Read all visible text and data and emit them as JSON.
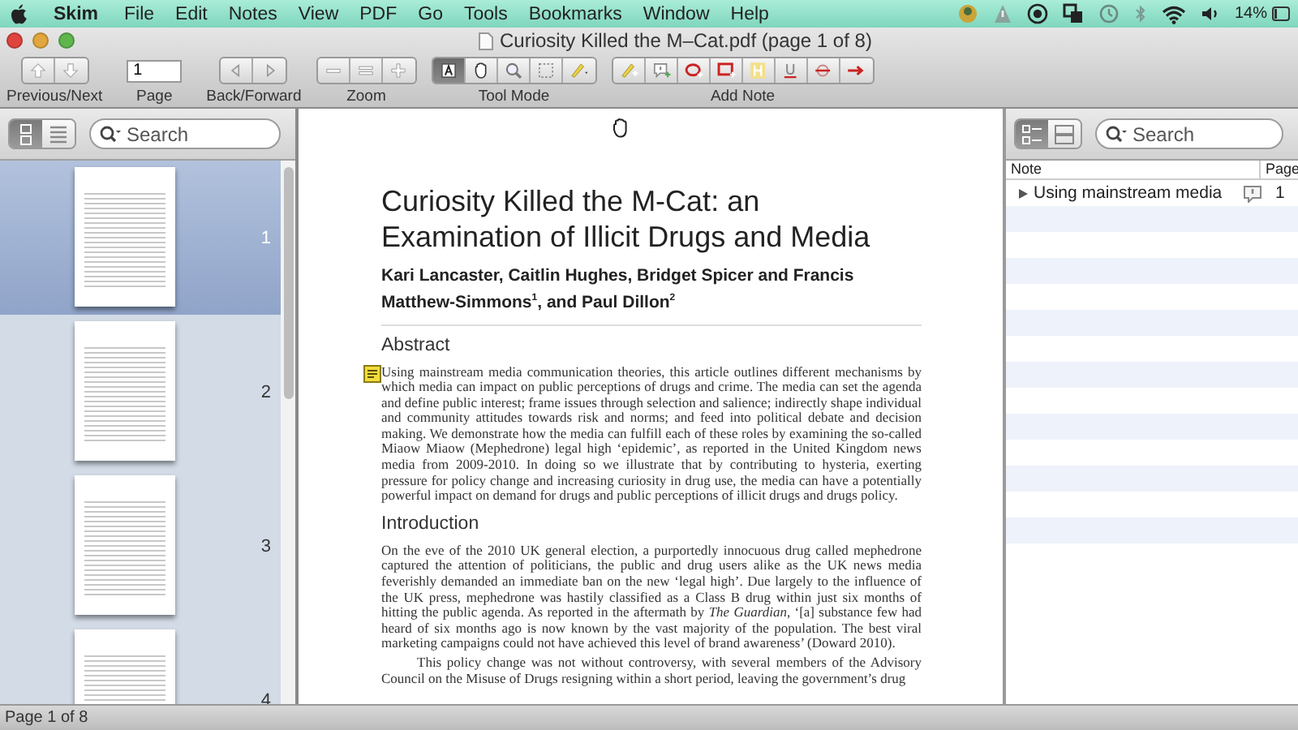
{
  "menu_bar": {
    "items": [
      {
        "label": "Skim",
        "kind": "app"
      },
      {
        "label": "File",
        "kind": "menu"
      },
      {
        "label": "Edit",
        "kind": "menu"
      },
      {
        "label": "Notes",
        "kind": "menu"
      },
      {
        "label": "View",
        "kind": "menu"
      },
      {
        "label": "PDF",
        "kind": "menu"
      },
      {
        "label": "Go",
        "kind": "menu"
      },
      {
        "label": "Tools",
        "kind": "menu"
      },
      {
        "label": "Bookmarks",
        "kind": "menu"
      },
      {
        "label": "Window",
        "kind": "menu"
      },
      {
        "label": "Help",
        "kind": "menu"
      }
    ],
    "battery": "14%"
  },
  "window": {
    "title": "Curiosity Killed the M–Cat.pdf (page 1 of 8)"
  },
  "toolbar": {
    "groups": [
      {
        "kind": "prev_next",
        "label": "Previous/Next"
      },
      {
        "kind": "page",
        "label": "Page",
        "value": "1"
      },
      {
        "kind": "back_forward",
        "label": "Back/Forward"
      },
      {
        "kind": "zoom",
        "label": "Zoom"
      },
      {
        "kind": "tool_mode",
        "label": "Tool Mode",
        "tools": [
          {
            "selected": true
          },
          {
            "selected": false
          },
          {
            "selected": false
          },
          {
            "selected": false
          },
          {
            "selected": false
          }
        ]
      },
      {
        "kind": "add_note",
        "label": "Add Note"
      }
    ]
  },
  "sidebar": {
    "views": [
      {
        "selected": true
      },
      {
        "selected": false
      }
    ],
    "search": {
      "placeholder": "Search"
    },
    "thumbnails": [
      {
        "label": "1",
        "selected": true
      },
      {
        "label": "2",
        "selected": false
      },
      {
        "label": "3",
        "selected": false
      },
      {
        "label": "4",
        "selected": false
      }
    ]
  },
  "document": {
    "title": "Curiosity Killed the M-Cat: an Examination of Illicit Drugs and Media",
    "authors": "Kari Lancaster, Caitlin Hughes, Bridget Spicer and Francis Matthew-Simmons$^{1}$, and Paul Dillon$^{2}$",
    "sections": [
      {
        "kind": "heading",
        "text": "Abstract"
      },
      {
        "kind": "paragraph",
        "note": true,
        "text": "Using mainstream media communication theories, this article outlines different mechanisms by which media can impact on public perceptions of drugs and crime. The media can set the agenda and define public interest; frame issues through selection and salience; indirectly shape individual and community attitudes towards risk and norms; and feed into political debate and decision making. We demonstrate how the media can fulfill each of these roles by examining the so-called Miaow Miaow (Mephedrone) legal high ‘epidemic’, as reported in the United Kingdom news media from 2009-2010. In doing so we illustrate that by contributing to hysteria, exerting pressure for policy change and increasing curiosity in drug use, the media can have a potentially powerful impact on demand for drugs and public perceptions of illicit drugs and drugs policy."
      },
      {
        "kind": "heading",
        "text": "Introduction"
      },
      {
        "kind": "paragraph",
        "note": false,
        "text": "On the eve of the 2010 UK general election, a purportedly innocuous drug called mephedrone captured the attention of politicians, the public and drug users alike as the UK news media feverishly demanded an immediate ban on the new ‘legal high’. Due largely to the influence of the UK press, mephedrone was hastily classified as a Class B drug within just six months of hitting the public agenda. As reported in the aftermath by *The Guardian*, ‘[a] substance few had heard of six months ago is now known by the vast majority of the population. The best viral marketing campaigns could not have achieved this level of brand awareness’ (Doward 2010)."
      },
      {
        "kind": "indented",
        "note": false,
        "text": "This policy change was not without controversy, with several members of the Advisory Council on the Misuse of Drugs resigning within a short period, leaving the government’s drug"
      }
    ]
  },
  "notes_panel": {
    "views": [
      {
        "selected": true
      },
      {
        "selected": false
      }
    ],
    "search": {
      "placeholder": "Search"
    },
    "columns": [
      "Note",
      "Page"
    ],
    "rows": [
      {
        "note": "Using mainstream media",
        "page": "1",
        "expanded": false
      }
    ]
  },
  "status_bar": {
    "text": "Page 1 of 8"
  }
}
